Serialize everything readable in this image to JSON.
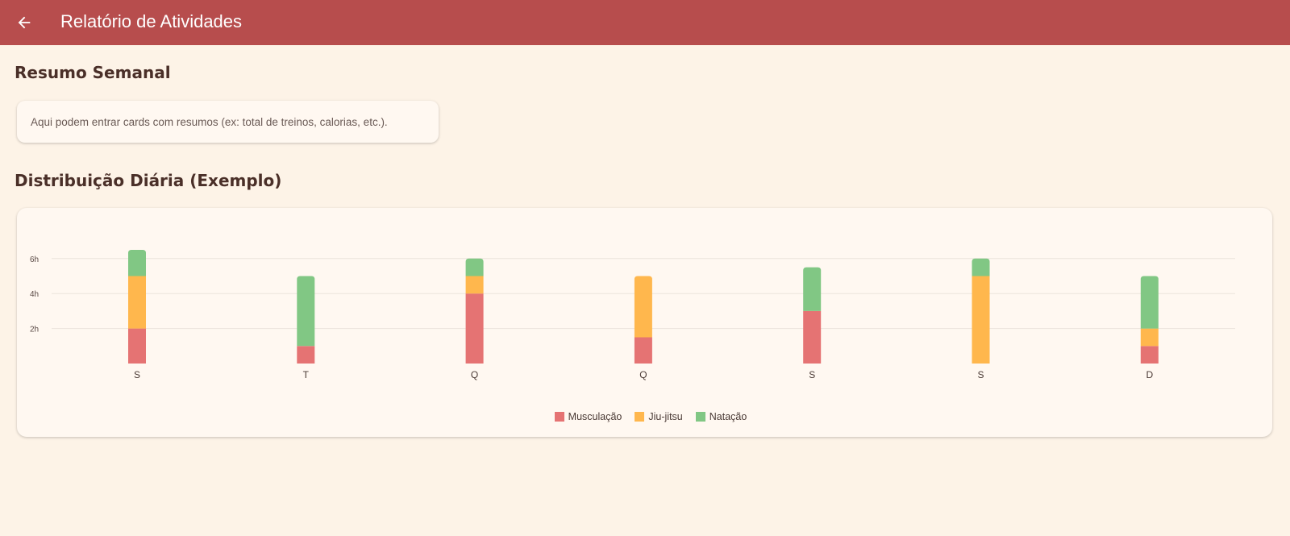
{
  "appbar": {
    "title": "Relatório de Atividades",
    "back_icon": "arrow-left-icon",
    "color": "#b74d4d"
  },
  "summary": {
    "title": "Resumo Semanal",
    "card_text": "Aqui podem entrar cards com resumos (ex: total de treinos, calorias, etc.)."
  },
  "distribution": {
    "title": "Distribuição Diária (Exemplo)"
  },
  "chart_data": {
    "type": "bar",
    "stacked": true,
    "categories": [
      "S",
      "T",
      "Q",
      "Q",
      "S",
      "S",
      "D"
    ],
    "series": [
      {
        "name": "Musculação",
        "color": "#e57373",
        "values": [
          2,
          1,
          4,
          1.5,
          3,
          0,
          1
        ]
      },
      {
        "name": "Jiu-jitsu",
        "color": "#ffb74d",
        "values": [
          3,
          0,
          1,
          3.5,
          0,
          5,
          1
        ]
      },
      {
        "name": "Natação",
        "color": "#81c784",
        "values": [
          1.5,
          4,
          1,
          0,
          2.5,
          1,
          3
        ]
      }
    ],
    "yticks": [
      "2h",
      "4h",
      "6h"
    ],
    "ylim": [
      0,
      7
    ],
    "grid": true,
    "legend": "bottom-center"
  }
}
